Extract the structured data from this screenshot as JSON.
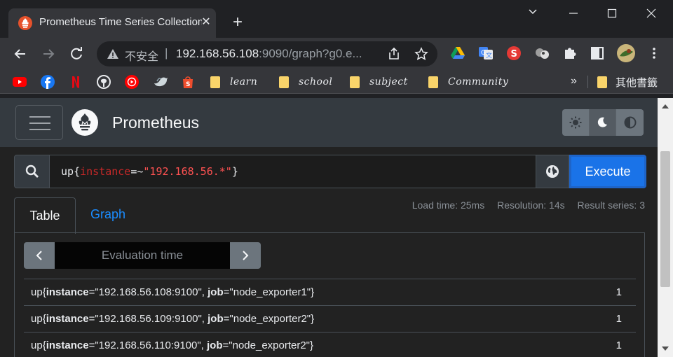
{
  "browser": {
    "tab_title": "Prometheus Time Series Collection and Processing Server",
    "tab_close": "✕",
    "new_tab": "+",
    "url_insecure_label": "不安全",
    "url_separator": "|",
    "url_host": "192.168.56.108",
    "url_rest": ":9090/graph?g0.e...",
    "icons": [
      "back-icon",
      "forward-icon",
      "reload-icon",
      "warning-icon",
      "share-icon",
      "star-icon",
      "google-drive-icon",
      "google-translate-icon",
      "extension-s-icon",
      "extension-balls-icon",
      "extensions-puzzle-icon",
      "sidebar-icon",
      "profile-avatar",
      "menu-kebab-icon"
    ]
  },
  "bookmarks": {
    "icons": [
      "youtube-icon",
      "facebook-icon",
      "netflix-icon",
      "github-icon",
      "youtube-music-icon",
      "bird-icon",
      "shopee-icon"
    ],
    "folders": [
      "learn",
      "school",
      "subject",
      "Community"
    ],
    "more": "»",
    "other_label": "其他書籤"
  },
  "app": {
    "brand": "Prometheus",
    "theme_buttons": [
      "light-theme",
      "dark-theme",
      "auto-theme"
    ],
    "query": {
      "metric": "up",
      "open_brace": "{",
      "label": "instance",
      "operator": "=~",
      "value": "\"192.168.56.*\"",
      "close_brace": "}"
    },
    "execute_label": "Execute",
    "tabs": {
      "table": "Table",
      "graph": "Graph"
    },
    "stats": {
      "load_time": "Load time: 25ms",
      "resolution": "Resolution: 14s",
      "result_series": "Result series: 3"
    },
    "eval_time_placeholder": "Evaluation time",
    "results": [
      {
        "metric": "up",
        "instance_key": "instance",
        "instance_val": "\"192.168.56.108:9100\"",
        "job_key": "job",
        "job_val": "\"node_exporter1\"",
        "value": "1"
      },
      {
        "metric": "up",
        "instance_key": "instance",
        "instance_val": "\"192.168.56.109:9100\"",
        "job_key": "job",
        "job_val": "\"node_exporter2\"",
        "value": "1"
      },
      {
        "metric": "up",
        "instance_key": "instance",
        "instance_val": "\"192.168.56.110:9100\"",
        "job_key": "job",
        "job_val": "\"node_exporter2\"",
        "value": "1"
      }
    ]
  },
  "colors": {
    "accent": "#1a73e8",
    "navbar": "#343a40",
    "background": "#222222",
    "query_label": "#c62828",
    "query_string": "#ff5252"
  }
}
